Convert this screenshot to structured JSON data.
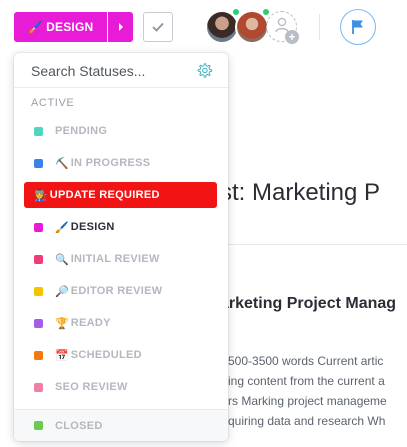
{
  "toolbar": {
    "status_label": "DESIGN",
    "status_emoji": "🖌️",
    "status_color": "#e81cd6",
    "next_status_icon": "chevron-right-icon",
    "complete_icon": "check-icon",
    "watch_icon": "flag-icon"
  },
  "assignees": [
    {
      "name": "avatar-1",
      "online": true
    },
    {
      "name": "avatar-2",
      "online": true
    }
  ],
  "dropdown": {
    "search_placeholder": "Search Statuses...",
    "settings_icon": "gear-icon",
    "section_label": "ACTIVE",
    "items": [
      {
        "label": "PENDING",
        "emoji": "",
        "color": "#4fd6be",
        "state": "normal"
      },
      {
        "label": "IN PROGRESS",
        "emoji": "⛏️",
        "color": "#3b82e6",
        "state": "normal"
      },
      {
        "label": "UPDATE REQUIRED",
        "emoji": "🧑‍🏭",
        "color": "#f21414",
        "state": "highlight"
      },
      {
        "label": "DESIGN",
        "emoji": "🖌️",
        "color": "#e81cd6",
        "state": "selected"
      },
      {
        "label": "INITIAL REVIEW",
        "emoji": "🔍",
        "color": "#ee3c7a",
        "state": "normal"
      },
      {
        "label": "EDITOR REVIEW",
        "emoji": "🔎",
        "color": "#f5c400",
        "state": "normal"
      },
      {
        "label": "READY",
        "emoji": "🏆",
        "color": "#a45ee8",
        "state": "normal"
      },
      {
        "label": "SCHEDULED",
        "emoji": "📅",
        "color": "#f27a13",
        "state": "normal"
      },
      {
        "label": "SEO REVIEW",
        "emoji": "",
        "color": "#ef7fa8",
        "state": "normal"
      }
    ],
    "closed": {
      "label": "CLOSED",
      "color": "#6bc950"
    }
  },
  "document": {
    "title": "st: Marketing P",
    "heading": "arketing Project Manag",
    "lines": [
      "500-3500 words Current artic",
      "ing content from the current a",
      "rs Marking project manageme",
      "quiring data and research Wh"
    ]
  }
}
